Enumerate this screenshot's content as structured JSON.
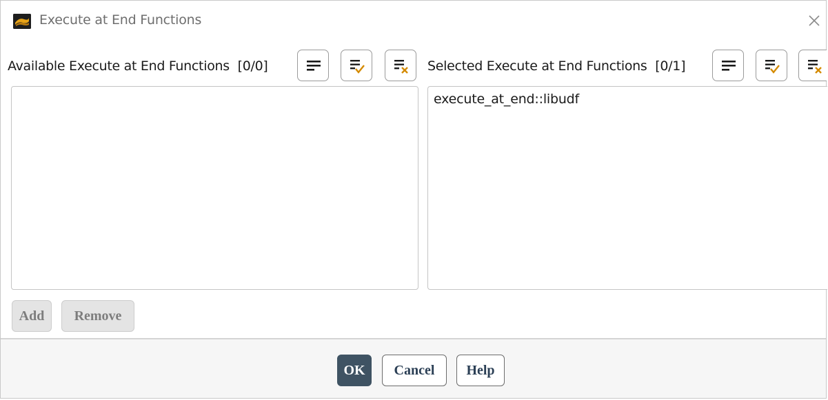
{
  "window": {
    "title": "Execute at End Functions",
    "icons": {
      "app": "fluent-app-icon",
      "close": "close-icon"
    }
  },
  "available": {
    "label": "Available Execute at End Functions",
    "count": "[0/0]",
    "items": [],
    "tools": [
      "list-all-icon",
      "select-all-icon",
      "deselect-all-icon"
    ]
  },
  "selected": {
    "label": "Selected Execute at End Functions",
    "count": "[0/1]",
    "items": [
      "execute_at_end::libudf"
    ],
    "tools": [
      "list-all-icon",
      "select-all-icon",
      "deselect-all-icon"
    ]
  },
  "actions": {
    "add": "Add",
    "remove": "Remove"
  },
  "footer": {
    "ok": "OK",
    "cancel": "Cancel",
    "help": "Help"
  },
  "colors": {
    "check": "#d48a00",
    "cross": "#d48a00",
    "primary_button": "#3f5363"
  }
}
